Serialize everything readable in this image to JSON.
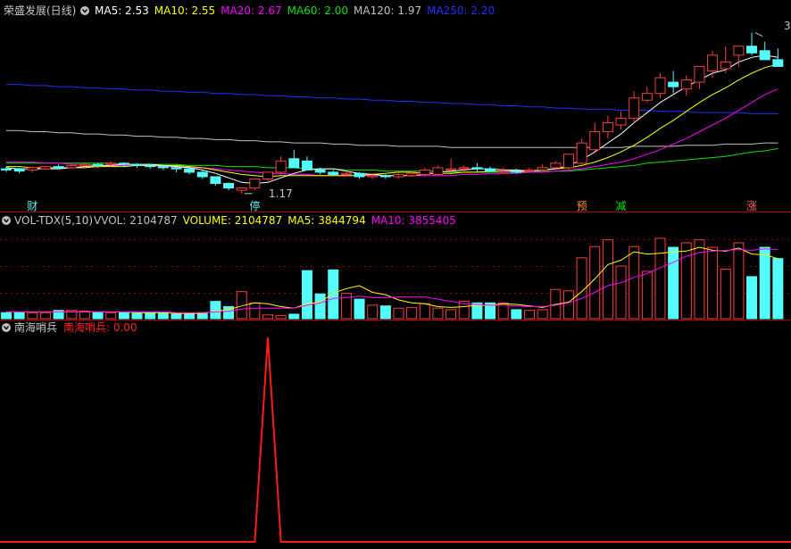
{
  "colors": {
    "background": "#000000",
    "up": "#ff3c3c",
    "down": "#54fcfc",
    "ma5": "#ffffff",
    "ma10": "#ffff00",
    "ma20": "#ff00ff",
    "ma60": "#00e600",
    "ma120": "#c0c0c0",
    "ma250": "#2030ff",
    "grid": "#9a0000",
    "signal": "#ff1a1a"
  },
  "header": {
    "price": {
      "title": "荣盛发展(日线)",
      "items": [
        {
          "label": "MA5: 2.53",
          "color": "#ffffff"
        },
        {
          "label": "MA10: 2.55",
          "color": "#ffff00"
        },
        {
          "label": "MA20: 2.67",
          "color": "#ff00ff"
        },
        {
          "label": "MA60: 2.00",
          "color": "#00e600"
        },
        {
          "label": "MA120: 1.97",
          "color": "#c0c0c0"
        },
        {
          "label": "MA250: 2.20",
          "color": "#2030ff"
        }
      ]
    },
    "volume": {
      "title": "VOL-TDX(5,10)",
      "items": [
        {
          "label": "VVOL: 2104787",
          "color": "#c0c0c0"
        },
        {
          "label": "VOLUME: 2104787",
          "color": "#ffff00"
        },
        {
          "label": "MA5: 3844794",
          "color": "#ffff00"
        },
        {
          "label": "MA10: 3855405",
          "color": "#ff00ff"
        }
      ]
    },
    "signal": {
      "title": "南海哨兵",
      "items": [
        {
          "label": "南海哨兵: 0.00",
          "color": "#ff2020"
        }
      ]
    }
  },
  "price_annotations": {
    "low": "1.17",
    "high": "3"
  },
  "event_tags": [
    {
      "label": "财",
      "color": "#54fcfc",
      "bar": 2
    },
    {
      "label": "停",
      "color": "#54fcfc",
      "bar": 19
    },
    {
      "label": "预",
      "color": "#ff9030",
      "bar": 44
    },
    {
      "label": "减",
      "color": "#00e600",
      "bar": 47
    },
    {
      "label": "涨",
      "color": "#ff6060",
      "bar": 57
    }
  ],
  "chart_data": [
    {
      "type": "candlestick",
      "title": "荣盛发展(日线)",
      "x": [
        1,
        2,
        3,
        4,
        5,
        6,
        7,
        8,
        9,
        10,
        11,
        12,
        13,
        14,
        15,
        16,
        17,
        18,
        19,
        20,
        21,
        22,
        23,
        24,
        25,
        26,
        27,
        28,
        29,
        30,
        31,
        32,
        33,
        34,
        35,
        36,
        37,
        38,
        39,
        40,
        41,
        42,
        43,
        44,
        45,
        46,
        47,
        48,
        49,
        50,
        51,
        52,
        53,
        54,
        55,
        56,
        57,
        58,
        59,
        60
      ],
      "open": [
        1.39,
        1.39,
        1.38,
        1.39,
        1.41,
        1.4,
        1.42,
        1.43,
        1.43,
        1.44,
        1.43,
        1.42,
        1.41,
        1.4,
        1.39,
        1.36,
        1.32,
        1.26,
        1.2,
        1.22,
        1.3,
        1.36,
        1.48,
        1.46,
        1.38,
        1.36,
        1.34,
        1.35,
        1.32,
        1.33,
        1.32,
        1.33,
        1.34,
        1.34,
        1.38,
        1.39,
        1.4,
        1.39,
        1.37,
        1.37,
        1.37,
        1.38,
        1.4,
        1.4,
        1.44,
        1.56,
        1.72,
        1.78,
        1.84,
        2.0,
        2.06,
        2.16,
        2.1,
        2.16,
        2.26,
        2.28,
        2.4,
        2.48,
        2.44,
        2.36
      ],
      "high": [
        1.41,
        1.4,
        1.41,
        1.42,
        1.43,
        1.43,
        1.45,
        1.44,
        1.46,
        1.45,
        1.44,
        1.43,
        1.42,
        1.41,
        1.4,
        1.38,
        1.32,
        1.27,
        1.22,
        1.3,
        1.36,
        1.5,
        1.56,
        1.5,
        1.4,
        1.38,
        1.37,
        1.36,
        1.35,
        1.34,
        1.35,
        1.37,
        1.4,
        1.42,
        1.48,
        1.42,
        1.44,
        1.41,
        1.4,
        1.39,
        1.4,
        1.43,
        1.46,
        1.52,
        1.66,
        1.8,
        1.86,
        1.9,
        2.08,
        2.12,
        2.24,
        2.26,
        2.22,
        2.28,
        2.44,
        2.48,
        2.48,
        2.6,
        2.52,
        2.46
      ],
      "low": [
        1.36,
        1.35,
        1.36,
        1.38,
        1.39,
        1.39,
        1.41,
        1.4,
        1.41,
        1.41,
        1.4,
        1.39,
        1.38,
        1.36,
        1.34,
        1.3,
        1.24,
        1.2,
        1.17,
        1.2,
        1.28,
        1.34,
        1.4,
        1.4,
        1.34,
        1.33,
        1.32,
        1.3,
        1.3,
        1.3,
        1.3,
        1.32,
        1.32,
        1.33,
        1.36,
        1.36,
        1.36,
        1.36,
        1.35,
        1.35,
        1.36,
        1.36,
        1.38,
        1.38,
        1.42,
        1.54,
        1.66,
        1.74,
        1.8,
        1.98,
        2.02,
        2.06,
        2.04,
        2.1,
        2.2,
        2.24,
        2.3,
        2.4,
        2.36,
        2.32
      ],
      "close": [
        1.38,
        1.37,
        1.4,
        1.41,
        1.4,
        1.42,
        1.43,
        1.42,
        1.44,
        1.43,
        1.42,
        1.41,
        1.4,
        1.39,
        1.36,
        1.32,
        1.26,
        1.22,
        1.22,
        1.3,
        1.36,
        1.46,
        1.4,
        1.38,
        1.36,
        1.34,
        1.35,
        1.32,
        1.33,
        1.32,
        1.34,
        1.35,
        1.38,
        1.4,
        1.39,
        1.4,
        1.39,
        1.37,
        1.37,
        1.36,
        1.38,
        1.4,
        1.44,
        1.52,
        1.62,
        1.72,
        1.8,
        1.84,
        2.02,
        2.06,
        2.2,
        2.12,
        2.18,
        2.3,
        2.4,
        2.34,
        2.48,
        2.42,
        2.36,
        2.3
      ],
      "ma_series": [
        {
          "name": "MA5",
          "values": [
            1.4,
            1.39,
            1.39,
            1.39,
            1.39,
            1.4,
            1.41,
            1.42,
            1.42,
            1.43,
            1.43,
            1.43,
            1.42,
            1.41,
            1.4,
            1.38,
            1.35,
            1.31,
            1.27,
            1.26,
            1.27,
            1.31,
            1.35,
            1.38,
            1.39,
            1.39,
            1.37,
            1.35,
            1.34,
            1.33,
            1.33,
            1.33,
            1.34,
            1.36,
            1.37,
            1.38,
            1.39,
            1.39,
            1.38,
            1.38,
            1.37,
            1.38,
            1.39,
            1.42,
            1.47,
            1.54,
            1.62,
            1.7,
            1.8,
            1.89,
            1.98,
            2.05,
            2.12,
            2.18,
            2.24,
            2.27,
            2.34,
            2.38,
            2.4,
            2.38
          ]
        },
        {
          "name": "MA10",
          "values": [
            1.41,
            1.41,
            1.4,
            1.4,
            1.4,
            1.4,
            1.4,
            1.41,
            1.41,
            1.41,
            1.42,
            1.42,
            1.42,
            1.42,
            1.41,
            1.4,
            1.38,
            1.36,
            1.34,
            1.33,
            1.32,
            1.33,
            1.33,
            1.33,
            1.33,
            1.33,
            1.33,
            1.33,
            1.34,
            1.35,
            1.36,
            1.36,
            1.35,
            1.35,
            1.35,
            1.36,
            1.36,
            1.37,
            1.37,
            1.37,
            1.37,
            1.38,
            1.39,
            1.4,
            1.42,
            1.45,
            1.49,
            1.54,
            1.6,
            1.67,
            1.75,
            1.82,
            1.9,
            1.98,
            2.05,
            2.11,
            2.18,
            2.24,
            2.29,
            2.32
          ]
        },
        {
          "name": "MA20",
          "values": [
            1.45,
            1.45,
            1.45,
            1.44,
            1.44,
            1.43,
            1.43,
            1.42,
            1.42,
            1.42,
            1.42,
            1.42,
            1.41,
            1.41,
            1.4,
            1.4,
            1.39,
            1.38,
            1.37,
            1.36,
            1.35,
            1.35,
            1.34,
            1.34,
            1.33,
            1.33,
            1.33,
            1.33,
            1.33,
            1.33,
            1.33,
            1.33,
            1.33,
            1.33,
            1.33,
            1.34,
            1.34,
            1.35,
            1.35,
            1.35,
            1.36,
            1.36,
            1.37,
            1.38,
            1.39,
            1.41,
            1.43,
            1.45,
            1.48,
            1.52,
            1.56,
            1.61,
            1.66,
            1.72,
            1.78,
            1.84,
            1.91,
            1.98,
            2.05,
            2.1
          ]
        },
        {
          "name": "MA60",
          "values": [
            1.44,
            1.44,
            1.44,
            1.44,
            1.44,
            1.44,
            1.44,
            1.44,
            1.44,
            1.43,
            1.43,
            1.43,
            1.43,
            1.43,
            1.42,
            1.42,
            1.42,
            1.41,
            1.41,
            1.41,
            1.4,
            1.4,
            1.4,
            1.39,
            1.39,
            1.39,
            1.38,
            1.38,
            1.38,
            1.37,
            1.37,
            1.37,
            1.37,
            1.37,
            1.36,
            1.36,
            1.36,
            1.36,
            1.36,
            1.36,
            1.36,
            1.37,
            1.37,
            1.37,
            1.38,
            1.39,
            1.4,
            1.41,
            1.42,
            1.44,
            1.45,
            1.46,
            1.47,
            1.48,
            1.49,
            1.5,
            1.52,
            1.54,
            1.55,
            1.57
          ]
        },
        {
          "name": "MA120",
          "values": [
            1.73,
            1.73,
            1.72,
            1.72,
            1.71,
            1.71,
            1.7,
            1.7,
            1.69,
            1.69,
            1.68,
            1.68,
            1.67,
            1.67,
            1.66,
            1.66,
            1.65,
            1.65,
            1.64,
            1.64,
            1.63,
            1.63,
            1.62,
            1.62,
            1.62,
            1.61,
            1.61,
            1.6,
            1.6,
            1.6,
            1.59,
            1.59,
            1.59,
            1.59,
            1.58,
            1.58,
            1.58,
            1.58,
            1.58,
            1.58,
            1.58,
            1.58,
            1.58,
            1.58,
            1.58,
            1.58,
            1.58,
            1.58,
            1.59,
            1.59,
            1.59,
            1.59,
            1.6,
            1.6,
            1.6,
            1.61,
            1.61,
            1.61,
            1.62,
            1.62
          ]
        },
        {
          "name": "MA250",
          "values": [
            2.14,
            2.14,
            2.13,
            2.13,
            2.12,
            2.12,
            2.11,
            2.11,
            2.1,
            2.1,
            2.09,
            2.09,
            2.08,
            2.08,
            2.07,
            2.07,
            2.06,
            2.06,
            2.05,
            2.05,
            2.04,
            2.04,
            2.03,
            2.03,
            2.02,
            2.02,
            2.01,
            2.01,
            2.0,
            2.0,
            1.99,
            1.99,
            1.98,
            1.98,
            1.97,
            1.97,
            1.96,
            1.96,
            1.95,
            1.95,
            1.94,
            1.94,
            1.93,
            1.93,
            1.92,
            1.92,
            1.92,
            1.91,
            1.91,
            1.91,
            1.9,
            1.9,
            1.9,
            1.89,
            1.89,
            1.89,
            1.89,
            1.88,
            1.88,
            1.88
          ]
        }
      ],
      "ylim": [
        1.05,
        2.7
      ]
    },
    {
      "type": "bar",
      "title": "VOL-TDX(5,10)",
      "values": [
        0.8,
        0.8,
        0.8,
        0.8,
        1.1,
        1.1,
        1.0,
        0.9,
        0.8,
        0.8,
        0.7,
        0.8,
        0.7,
        0.6,
        0.6,
        0.8,
        2.3,
        1.6,
        3.6,
        2.1,
        0.5,
        0.4,
        0.6,
        6.4,
        3.3,
        6.5,
        3.4,
        2.6,
        1.8,
        1.7,
        1.4,
        1.5,
        2.0,
        1.4,
        1.2,
        2.3,
        2.1,
        2.1,
        2.1,
        1.2,
        1.1,
        1.2,
        3.9,
        3.7,
        8.1,
        9.6,
        10.5,
        7.0,
        9.6,
        6.3,
        10.7,
        9.5,
        10.1,
        10.5,
        9.5,
        6.6,
        10.1,
        5.6,
        9.5,
        8.0
      ],
      "series": [
        {
          "name": "MA5",
          "values": [
            0.9,
            0.9,
            0.9,
            0.9,
            0.9,
            0.9,
            0.9,
            0.9,
            0.9,
            0.9,
            0.8,
            0.8,
            0.8,
            0.7,
            0.7,
            0.7,
            1.0,
            1.2,
            1.7,
            2.1,
            2.0,
            1.6,
            1.4,
            2.0,
            2.2,
            3.4,
            4.0,
            4.4,
            3.5,
            3.2,
            2.5,
            2.1,
            2.0,
            1.6,
            1.5,
            1.6,
            1.8,
            1.8,
            2.0,
            1.9,
            1.7,
            1.5,
            1.9,
            2.2,
            3.6,
            5.3,
            7.2,
            7.8,
            8.9,
            8.6,
            8.7,
            8.9,
            9.0,
            9.5,
            9.1,
            9.0,
            9.4,
            8.6,
            8.5,
            8.0
          ]
        },
        {
          "name": "MA10",
          "values": [
            0.9,
            0.9,
            0.9,
            0.9,
            0.9,
            0.9,
            0.9,
            0.9,
            0.9,
            0.9,
            0.9,
            0.9,
            0.9,
            0.8,
            0.8,
            0.8,
            0.9,
            1.0,
            1.3,
            1.4,
            1.4,
            1.4,
            1.4,
            1.8,
            2.1,
            2.7,
            2.8,
            3.0,
            2.8,
            2.8,
            2.9,
            2.9,
            2.9,
            2.6,
            2.3,
            2.0,
            1.9,
            1.8,
            1.8,
            1.7,
            1.6,
            1.6,
            1.8,
            2.1,
            2.7,
            3.5,
            4.4,
            4.8,
            5.5,
            6.0,
            6.8,
            7.5,
            8.3,
            8.8,
            9.0,
            9.1,
            9.2,
            9.1,
            9.3,
            9.2
          ]
        }
      ],
      "ylim": [
        0,
        12
      ]
    },
    {
      "type": "line",
      "title": "南海哨兵",
      "values": [
        0,
        0,
        0,
        0,
        0,
        0,
        0,
        0,
        0,
        0,
        0,
        0,
        0,
        0,
        0,
        0,
        0,
        0,
        0,
        0,
        1,
        0,
        0,
        0,
        0,
        0,
        0,
        0,
        0,
        0,
        0,
        0,
        0,
        0,
        0,
        0,
        0,
        0,
        0,
        0,
        0,
        0,
        0,
        0,
        0,
        0,
        0,
        0,
        0,
        0,
        0,
        0,
        0,
        0,
        0,
        0,
        0,
        0,
        0,
        0
      ],
      "ylim": [
        0,
        1.2
      ]
    }
  ]
}
